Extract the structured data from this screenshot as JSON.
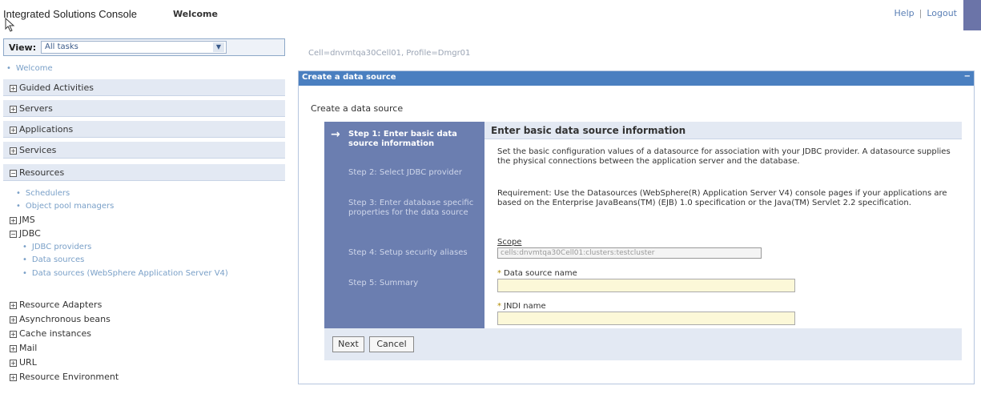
{
  "header": {
    "app_title": "Integrated Solutions Console",
    "welcome": "Welcome",
    "help": "Help",
    "separator": "|",
    "logout": "Logout"
  },
  "sidebar": {
    "view_label": "View:",
    "view_value": "All tasks",
    "welcome_link": "Welcome",
    "groups": [
      {
        "label": "Guided Activities",
        "expanded": false
      },
      {
        "label": "Servers",
        "expanded": false
      },
      {
        "label": "Applications",
        "expanded": false
      },
      {
        "label": "Services",
        "expanded": false
      },
      {
        "label": "Resources",
        "expanded": true
      }
    ],
    "resources": {
      "schedulers": "Schedulers",
      "object_pool_managers": "Object pool managers",
      "jms": "JMS",
      "jdbc": "JDBC",
      "jdbc_providers": "JDBC providers",
      "data_sources": "Data sources",
      "data_sources_v4": "Data sources (WebSphere Application Server V4)",
      "resource_adapters": "Resource Adapters",
      "asynchronous_beans": "Asynchronous beans",
      "cache_instances": "Cache instances",
      "mail": "Mail",
      "url": "URL",
      "resource_environment": "Resource Environment"
    }
  },
  "main": {
    "cell_profile": "Cell=dnvmtqa30Cell01, Profile=Dmgr01",
    "panel_title": "Create a data source",
    "panel_min": "−",
    "wizard_heading": "Create a data source",
    "steps": [
      {
        "label": "Step 1: Enter basic data source information",
        "current": true
      },
      {
        "label": "Step 2: Select JDBC provider",
        "current": false
      },
      {
        "label": "Step 3: Enter database specific properties for the data source",
        "current": false
      },
      {
        "label": "Step 4: Setup security aliases",
        "current": false
      },
      {
        "label": "Step 5: Summary",
        "current": false
      }
    ],
    "content_title": "Enter basic data source information",
    "description": "Set the basic configuration values of a datasource for association with your JDBC provider. A datasource supplies the physical connections between the application server and the database.",
    "requirement": "Requirement: Use the Datasources (WebSphere(R) Application Server V4) console pages if your applications are based on the Enterprise JavaBeans(TM) (EJB) 1.0 specification or the Java(TM) Servlet 2.2 specification.",
    "scope_label": "Scope",
    "scope_value": "cells:dnvmtqa30Cell01:clusters:testcluster",
    "required_marker": "*",
    "data_source_name_label": "Data source name",
    "data_source_name_value": "",
    "jndi_name_label": "JNDI name",
    "jndi_name_value": "",
    "next_label": "Next",
    "cancel_label": "Cancel"
  },
  "colors": {
    "accent": "#4a7fc0",
    "wizard_steps_bg": "#6b7eb0",
    "nav_bg": "#e3e9f3",
    "required_field_bg": "#fcf8d8",
    "link": "#7aa0c8"
  }
}
